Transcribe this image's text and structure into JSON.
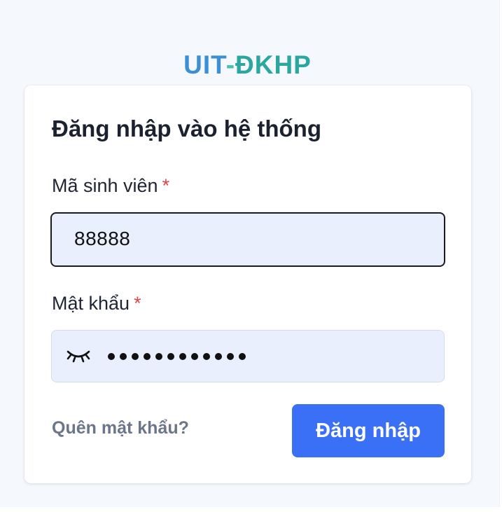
{
  "logo": {
    "part1": "UIT",
    "dash": "-",
    "part2": "ĐKHP",
    "colors": {
      "uit": "#3c8fd6",
      "dash": "#47c1b0",
      "dkhp": "#2ba7a0"
    }
  },
  "login_form": {
    "title": "Đăng nhập vào hệ thống",
    "student_id": {
      "label": "Mã sinh viên",
      "required_mark": "*",
      "value": "88888"
    },
    "password": {
      "label": "Mật khẩu",
      "required_mark": "*",
      "masked_length": 12,
      "toggle_icon": "eye-closed-icon"
    },
    "forgot_link": "Quên mật khẩu?",
    "submit_label": "Đăng nhập"
  },
  "colors": {
    "page_background": "#f5f8fc",
    "input_background": "#e9effc",
    "primary_button": "#3a70f5",
    "required": "#e04444",
    "link": "#6b7689"
  }
}
